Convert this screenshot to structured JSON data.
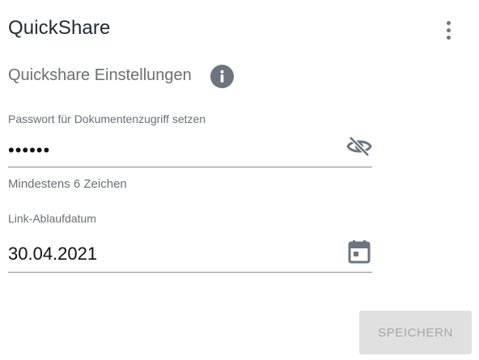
{
  "header": {
    "title": "QuickShare",
    "more_icon": "more-vert-icon"
  },
  "section": {
    "title": "Quickshare Einstellungen",
    "info_icon": "info-icon"
  },
  "password": {
    "label": "Passwort für Dokumentenzugriff setzen",
    "value": "••••••",
    "hint": "Mindestens 6 Zeichen",
    "toggle_icon": "visibility-off-icon"
  },
  "expiry": {
    "label": "Link-Ablaufdatum",
    "value": "30.04.2021",
    "icon": "calendar-icon"
  },
  "actions": {
    "save_label": "SPEICHERN"
  },
  "colors": {
    "icon_gray": "#6b747f",
    "button_disabled_bg": "#e0e0e0",
    "button_disabled_text": "#a6a6a6"
  }
}
